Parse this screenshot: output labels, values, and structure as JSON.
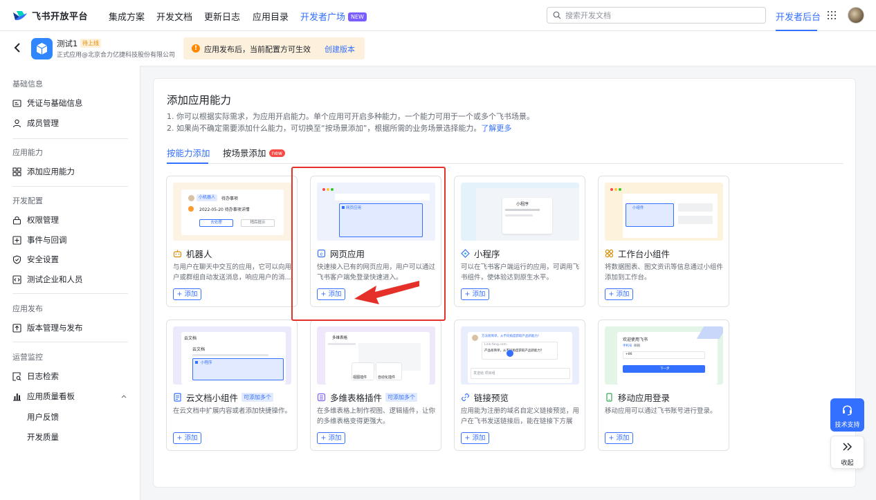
{
  "brand": {
    "name": "飞书开放平台"
  },
  "nav": {
    "items": [
      "集成方案",
      "开发文档",
      "更新日志",
      "应用目录"
    ],
    "dev_square": "开发者广场",
    "dev_square_badge": "NEW",
    "search_placeholder": "搜索开发文档",
    "dev_backend": "开发者后台"
  },
  "app": {
    "name": "测试1",
    "status": "待上线",
    "org": "正式应用@北京合力亿捷科技股份有限公司",
    "notice": "应用发布后，当前配置方可生效",
    "notice_action": "创建版本"
  },
  "sidebar": {
    "sections": [
      {
        "title": "基础信息",
        "items": [
          "凭证与基础信息",
          "成员管理"
        ]
      },
      {
        "title": "应用能力",
        "items": [
          "添加应用能力"
        ]
      },
      {
        "title": "开发配置",
        "items": [
          "权限管理",
          "事件与回调",
          "安全设置",
          "测试企业和人员"
        ]
      },
      {
        "title": "应用发布",
        "items": [
          "版本管理与发布"
        ]
      },
      {
        "title": "运营监控",
        "items": [
          "日志检索",
          "应用质量看板"
        ],
        "sub": [
          "用户反馈",
          "开发质量"
        ]
      }
    ]
  },
  "main": {
    "title": "添加应用能力",
    "desc1": "1. 你可以根据实际需求，为应用开启能力。单个应用可开启多种能力，一个能力可用于一个或多个飞书场景。",
    "desc2": "2. 如果尚不确定需要添加什么能力，可切换至“按场景添加”，根据所需的业务场景选择能力。",
    "learn_more": "了解更多",
    "tabs": [
      {
        "label": "按能力添加"
      },
      {
        "label": "按场景添加",
        "badge": "new"
      }
    ],
    "add_label": "+ 添加",
    "multi_badge": "可添加多个",
    "cards": [
      {
        "name": "机器人",
        "desc": "与用户在聊天中交互的应用，它可以向用户或群组自动发送消息，响应用户的消...",
        "icon": "robot-icon"
      },
      {
        "name": "网页应用",
        "desc": "快速接入已有的网页应用，用户可以通过飞书客户端免登录快速进入。",
        "icon": "web-app-icon"
      },
      {
        "name": "小程序",
        "desc": "可以在飞书客户端运行的应用，可调用飞书组件，使体验达到原生水平。",
        "icon": "mini-program-icon"
      },
      {
        "name": "工作台小组件",
        "desc": "将数据图表、图文资讯等信息通过小组件添加到工作台。",
        "icon": "widget-icon"
      },
      {
        "name": "云文档小组件",
        "desc": "在云文档中扩展内容或者添加快捷操作。",
        "icon": "doc-widget-icon",
        "multi": true
      },
      {
        "name": "多维表格插件",
        "desc": "在多维表格上制作视图、逻辑插件，让你的多维表格变得更强大。",
        "icon": "base-plugin-icon",
        "multi": true
      },
      {
        "name": "链接预览",
        "desc": "应用能为注册的域名自定义链接预览，用户在飞书发送链接后，能在链接下方展示...",
        "icon": "link-icon"
      },
      {
        "name": "移动应用登录",
        "desc": "移动应用可以通过飞书账号进行登录。",
        "icon": "mobile-login-icon"
      }
    ],
    "thumbs": {
      "robot_tag": "小机器人",
      "robot_sub": "待办事项",
      "robot_line": "2022-05-20 待办事项详情",
      "robot_btn1": "去处理",
      "robot_btn2": "稍后提示",
      "web_tab": "网页应用",
      "mini_title": "小程序",
      "widget_title": "小组件",
      "doc_header": "云文档",
      "doc_title": "云文档",
      "doc_item": "小程序",
      "base_header": "多维表格",
      "base_btn1": "视图插件",
      "base_btn2": "自动化插件",
      "link_msg": "方法很简单，从不同角度获取产品新能力！",
      "link_domain": "Link-fang.com",
      "link_title": "产品很简单，从不同角度获取产品新能力？",
      "link_input": "发送给 项目组",
      "login_title": "欢迎使用飞书",
      "login_tab1": "手机号",
      "login_tab2": "邮箱",
      "login_code": "+86",
      "login_btn": "下一步"
    }
  },
  "float": {
    "support": "技术支持",
    "collapse": "收起"
  },
  "colors": {
    "accent": "#3370ff",
    "highlight": "#e5302a",
    "warning": "#ff8800"
  }
}
